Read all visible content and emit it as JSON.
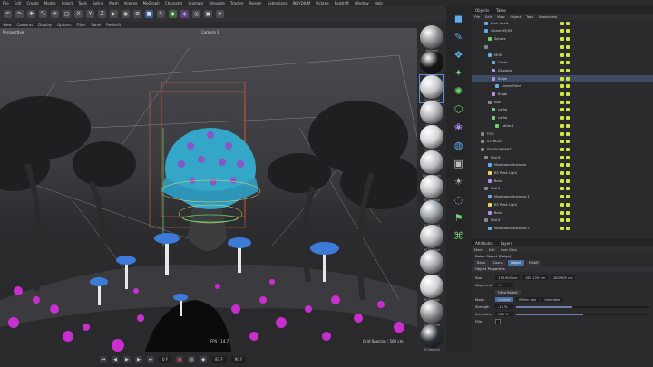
{
  "menubar": [
    "File",
    "Edit",
    "Create",
    "Modes",
    "Select",
    "Tools",
    "Spline",
    "Mesh",
    "Volume",
    "MoGraph",
    "Character",
    "Animate",
    "Simulate",
    "Tracker",
    "Render",
    "Extensions",
    "INSYDIUM",
    "Octane",
    "Redshift",
    "Window",
    "Help"
  ],
  "viewport": {
    "menu": [
      "View",
      "Cameras",
      "Display",
      "Options",
      "Filter",
      "Panel",
      "Redshift"
    ],
    "label": "Perspective",
    "camera_label": "Camera 3",
    "fps": "FPS : 14.7",
    "grid_spacing": "Grid Spacing : 500 cm"
  },
  "timeline": {
    "frame": "0 F",
    "current": "87 F",
    "end": "90 F"
  },
  "materials": [
    {
      "label": "Material",
      "color": "#8f8f93"
    },
    {
      "label": "Material",
      "color": "#141414"
    },
    {
      "label": "RS Material",
      "color": "#c9c9cc",
      "selected": true
    },
    {
      "label": "Dirtmap",
      "color": "#b0b0b5"
    },
    {
      "label": "RS Material",
      "color": "#d5d5d8"
    },
    {
      "label": "Dirtmap.skin",
      "color": "#bdbdc2"
    },
    {
      "label": "RS Material",
      "color": "#c2c2c6"
    },
    {
      "label": "RS Material",
      "color": "#9aa0a8"
    },
    {
      "label": "RS Material",
      "color": "#b8b8bc"
    },
    {
      "label": "RS Material",
      "color": "#a6a6ab"
    },
    {
      "label": "RS Standar",
      "color": "#cfcfd3"
    },
    {
      "label": "RS Standar",
      "color": "#8c8c90"
    },
    {
      "label": "RS Material",
      "color": "#2a2d36"
    }
  ],
  "object_manager": {
    "tabs": [
      "Objects",
      "Takes"
    ],
    "menu": [
      "File",
      "Edit",
      "View",
      "Object",
      "Tags",
      "Bookmarks"
    ],
    "rows": [
      {
        "name": "Push Apart",
        "indent": 4,
        "color": "#5fb0e8"
      },
      {
        "name": "Cloner 05/05",
        "indent": 4,
        "color": "#5fb0e8"
      },
      {
        "name": "Sphere",
        "indent": 6,
        "color": "#6fd06f"
      },
      {
        "name": "",
        "indent": 4,
        "color": "#888"
      },
      {
        "name": "MUS",
        "indent": 6,
        "color": "#5fb0e8"
      },
      {
        "name": "Circle",
        "indent": 8,
        "color": "#5fb0e8"
      },
      {
        "name": "Displacer",
        "indent": 8,
        "color": "#b48ef0"
      },
      {
        "name": "Bulge",
        "indent": 8,
        "color": "#b48ef0"
      },
      {
        "name": "Linear Field",
        "indent": 10,
        "color": "#5fb0e8"
      },
      {
        "name": "Bulge",
        "indent": 8,
        "color": "#b48ef0"
      },
      {
        "name": "Null",
        "indent": 6,
        "color": "#888"
      },
      {
        "name": "Lathe",
        "indent": 8,
        "color": "#6fd06f"
      },
      {
        "name": "Lathe",
        "indent": 8,
        "color": "#6fd06f"
      },
      {
        "name": "Lathe.1",
        "indent": 10,
        "color": "#6fd06f"
      },
      {
        "name": "FOG",
        "indent": 2,
        "color": "#888"
      },
      {
        "name": "STENCILS",
        "indent": 2,
        "color": "#888"
      },
      {
        "name": "ENVIRONMENT",
        "indent": 2,
        "color": "#888"
      },
      {
        "name": "Null.6",
        "indent": 4,
        "color": "#888"
      },
      {
        "name": "Mushroom Instance",
        "indent": 6,
        "color": "#5fb0e8"
      },
      {
        "name": "RS Point Light",
        "indent": 6,
        "color": "#e8d35f"
      },
      {
        "name": "Bend",
        "indent": 6,
        "color": "#b48ef0"
      },
      {
        "name": "Null.5",
        "indent": 4,
        "color": "#888"
      },
      {
        "name": "Mushroom Instance.1",
        "indent": 6,
        "color": "#5fb0e8"
      },
      {
        "name": "RS Point Light",
        "indent": 6,
        "color": "#e8d35f"
      },
      {
        "name": "Bend",
        "indent": 6,
        "color": "#b48ef0"
      },
      {
        "name": "Null.4",
        "indent": 4,
        "color": "#888"
      },
      {
        "name": "Mushroom Instance.2",
        "indent": 6,
        "color": "#5fb0e8"
      }
    ]
  },
  "attributes": {
    "tabs": [
      "Attributes",
      "Layers"
    ],
    "submenu": [
      "Mode",
      "Edit",
      "User Data"
    ],
    "object_title": "Bulge Object [Bulge]",
    "subtabs": [
      "Basic",
      "Coord.",
      "Object",
      "Falloff"
    ],
    "active_subtab": "Object",
    "section": "Object Properties",
    "size_label": "Size",
    "size_values": [
      "173.905 cm",
      "405.129 cm",
      "283.905 cm"
    ],
    "alignment_label": "Alignment",
    "alignment_value": "Y+",
    "fit_button": "Fit to Parent",
    "mode_label": "Mode",
    "mode_options": [
      "Limited",
      "Within Box",
      "Unlimited"
    ],
    "strength_label": "Strength",
    "strength_value": "-15 %",
    "strength_fraction": 0.42,
    "curvature_label": "Curvature",
    "curvature_value": "100 %",
    "curvature_fraction": 0.5,
    "fillet_label": "Fillet"
  }
}
